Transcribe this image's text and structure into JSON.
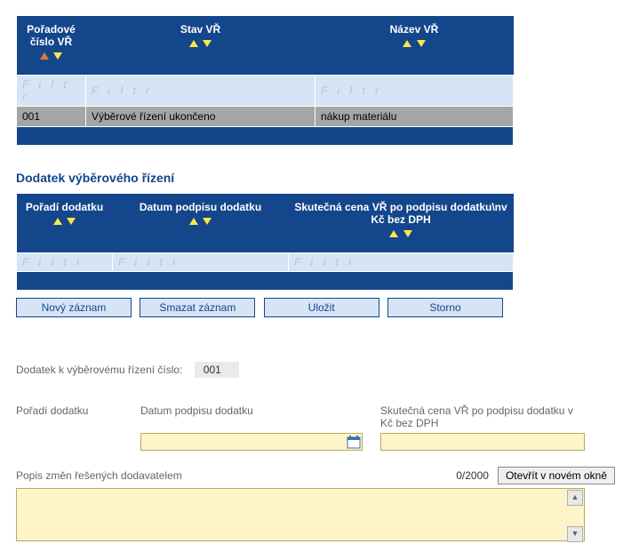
{
  "table1": {
    "headers": [
      "Pořadové číslo VŘ",
      "Stav VŘ",
      "Název VŘ"
    ],
    "filter_text": "F i l t r",
    "row": {
      "num": "001",
      "stav": "Výběrové řízení ukončeno",
      "nazev": "nákup materiálu"
    }
  },
  "section_title": "Dodatek výběrového řízení",
  "table2": {
    "headers": [
      "Pořadí dodatku",
      "Datum podpisu dodatku",
      "Skutečná cena VŘ po podpisu dodatku\\nv Kč bez DPH"
    ],
    "filter_text": "F i l t r"
  },
  "buttons": {
    "novy": "Nový záznam",
    "smazat": "Smazat záznam",
    "ulozit": "Uložit",
    "storno": "Storno"
  },
  "form": {
    "ref_label": "Dodatek k výběrovému řízení číslo:",
    "ref_value": "001",
    "poradi_label": "Pořadí dodatku",
    "datum_label": "Datum podpisu dodatku",
    "cena_label": "Skutečná cena VŘ po podpisu dodatku v Kč bez DPH",
    "popis_label": "Popis změn řešených dodavatelem",
    "counter": "0/2000",
    "open_label": "Otevřít v novém okně"
  }
}
